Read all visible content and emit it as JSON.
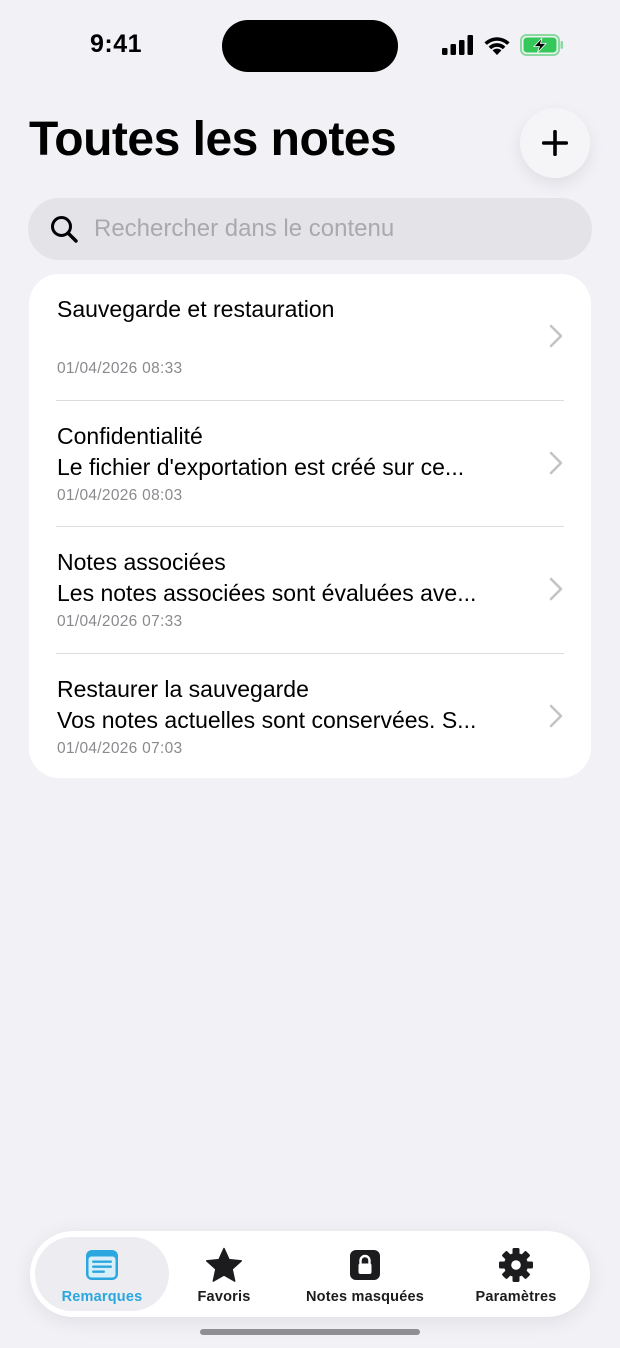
{
  "status_bar": {
    "time": "9:41",
    "icons": [
      "signal-icon",
      "wifi-icon",
      "battery-charging-icon"
    ]
  },
  "header": {
    "title": "Toutes les notes",
    "add_icon": "plus-icon"
  },
  "search": {
    "placeholder": "Rechercher dans le contenu",
    "value": "",
    "icon": "search-icon"
  },
  "notes": [
    {
      "title": "Sauvegarde et restauration",
      "preview": "",
      "date": "01/04/2026 08:33"
    },
    {
      "title": "Confidentialité",
      "preview": "Le fichier d'exportation est créé sur ce...",
      "date": "01/04/2026 08:03"
    },
    {
      "title": "Notes associées",
      "preview": "Les notes associées sont évaluées ave...",
      "date": "01/04/2026 07:33"
    },
    {
      "title": "Restaurer la sauvegarde",
      "preview": "Vos notes actuelles sont conservées. S...",
      "date": "01/04/2026 07:03"
    }
  ],
  "tabs": [
    {
      "label": "Remarques",
      "icon": "notes-icon",
      "active": true
    },
    {
      "label": "Favoris",
      "icon": "star-icon",
      "active": false
    },
    {
      "label": "Notes masquées",
      "icon": "lock-icon",
      "active": false
    },
    {
      "label": "Paramètres",
      "icon": "gear-icon",
      "active": false
    }
  ],
  "colors": {
    "background": "#f1f1f6",
    "accent": "#2aa7de",
    "battery": "#34c759"
  }
}
